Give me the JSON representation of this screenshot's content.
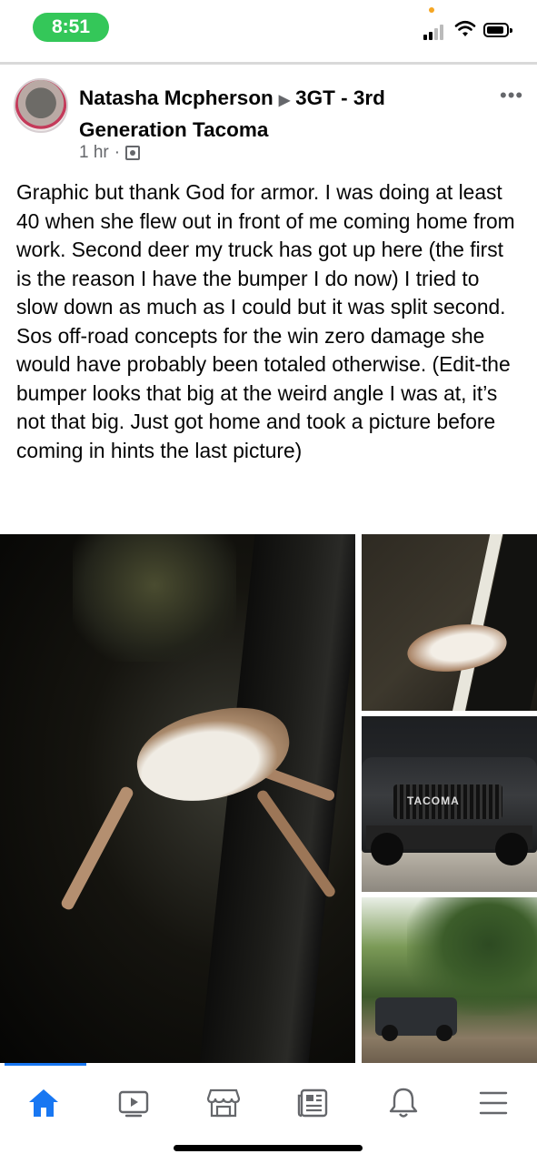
{
  "status_bar": {
    "time": "8:51",
    "indicators": [
      "signal-icon",
      "wifi-icon",
      "battery-icon"
    ]
  },
  "post": {
    "author": "Natasha Mcpherson",
    "group": "3GT - 3rd Generation Tacoma",
    "time_ago": "1 hr",
    "audience_icon": "group-icon",
    "more_icon": "more-options-icon",
    "text": "Graphic but thank God for armor. I was doing at least 40 when she flew out in front of me coming home from work. Second deer my truck has got up here (the first is the reason I have the bumper I do now) I tried to slow down as much as I could but it was split second. Sos off-road concepts for the win zero damage she would have probably been totaled otherwise. (Edit-the bumper looks that big at the weird angle I was at, it’s not that big. Just got home and took a picture before coming in hints the last picture)",
    "bumper_logo_text": "TACOMA"
  },
  "tab_bar": {
    "active": "home",
    "tabs": [
      "home-icon",
      "video-icon",
      "marketplace-icon",
      "news-icon",
      "notifications-icon",
      "menu-icon"
    ],
    "accent": "#1877f2"
  }
}
